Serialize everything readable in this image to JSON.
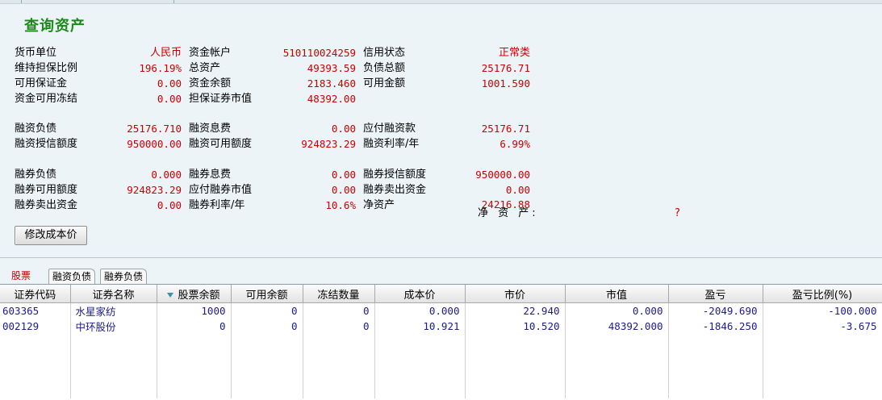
{
  "page_title": "查询资产",
  "info_rows": [
    [
      [
        "货币单位",
        "人民币"
      ],
      [
        "资金帐户",
        "510110024259"
      ],
      [
        "信用状态",
        "正常类"
      ]
    ],
    [
      [
        "维持担保比例",
        "196.19%"
      ],
      [
        "总资产",
        "49393.59"
      ],
      [
        "负债总额",
        "25176.71"
      ]
    ],
    [
      [
        "可用保证金",
        "0.00"
      ],
      [
        "资金余额",
        "2183.460"
      ],
      [
        "可用金额",
        "1001.590"
      ]
    ],
    [
      [
        "资金可用冻结",
        "0.00"
      ],
      [
        "担保证券市值",
        "48392.00"
      ],
      [
        "",
        ""
      ]
    ],
    [
      [
        "融资负债",
        "25176.710"
      ],
      [
        "融资息费",
        "0.00"
      ],
      [
        "应付融资款",
        "25176.71"
      ]
    ],
    [
      [
        "融资授信额度",
        "950000.00"
      ],
      [
        "融资可用额度",
        "924823.29"
      ],
      [
        "融资利率/年",
        "6.99%"
      ]
    ],
    [
      [
        "融券负债",
        "0.000"
      ],
      [
        "融券息费",
        "0.00"
      ],
      [
        "融券授信额度",
        "950000.00"
      ]
    ],
    [
      [
        "融券可用额度",
        "924823.29"
      ],
      [
        "应付融券市值",
        "0.00"
      ],
      [
        "融券卖出资金",
        "0.00"
      ]
    ],
    [
      [
        "融券卖出资金",
        "0.00"
      ],
      [
        "融券利率/年",
        "10.6%"
      ],
      [
        "净资产",
        "24216.88"
      ]
    ]
  ],
  "overlap_label": "净 资 产:",
  "overlap_value": "?",
  "modify_cost_button": "修改成本价",
  "tabs": [
    "股票",
    "融资负债",
    "融券负债"
  ],
  "grid": {
    "columns": [
      "证券代码",
      "证券名称",
      "股票余额",
      "可用余额",
      "冻结数量",
      "成本价",
      "市价",
      "市值",
      "盈亏",
      "盈亏比例(%)"
    ],
    "sorted_column_icon": "triangle-down-icon",
    "rows": [
      [
        "603365",
        "水星家纺",
        "1000",
        "0",
        "0",
        "0.000",
        "22.940",
        "0.000",
        "-2049.690",
        "-100.000"
      ],
      [
        "002129",
        "中环股份",
        "0",
        "0",
        "0",
        "10.921",
        "10.520",
        "48392.000",
        "-1846.250",
        "-3.675"
      ]
    ]
  }
}
